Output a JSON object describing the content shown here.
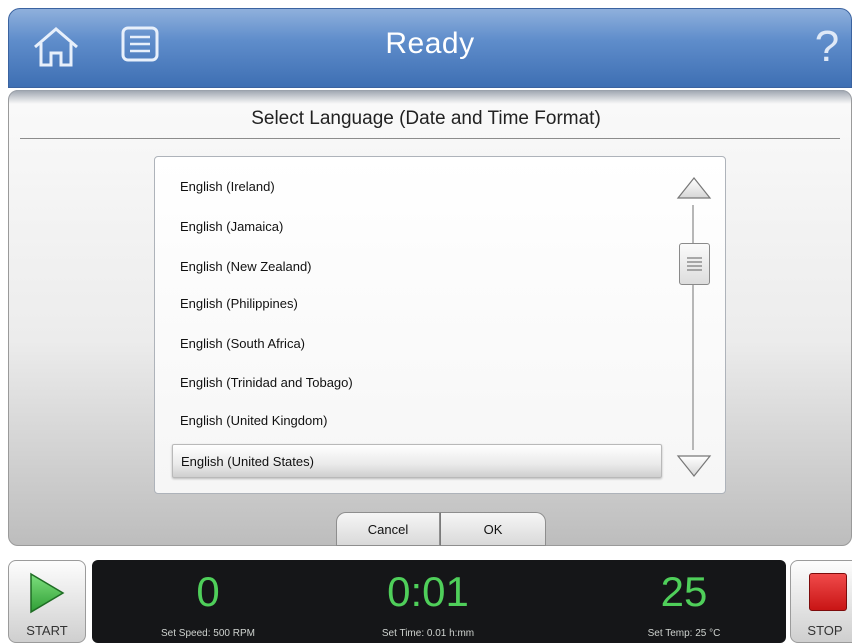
{
  "header": {
    "title": "Ready",
    "help_glyph": "?"
  },
  "dialog": {
    "title": "Select Language (Date and Time Format)",
    "items": [
      {
        "label": "English (Ireland)",
        "selected": false
      },
      {
        "label": "English (Jamaica)",
        "selected": false
      },
      {
        "label": "English (New Zealand)",
        "selected": false
      },
      {
        "label": "English (Philippines)",
        "selected": false
      },
      {
        "label": "English (South Africa)",
        "selected": false
      },
      {
        "label": "English (Trinidad and Tobago)",
        "selected": false
      },
      {
        "label": "English (United Kingdom)",
        "selected": false
      },
      {
        "label": "English (United States)",
        "selected": true
      }
    ],
    "cancel_label": "Cancel",
    "ok_label": "OK"
  },
  "controls": {
    "start_label": "START",
    "stop_label": "STOP"
  },
  "status": {
    "speed_value": "0",
    "speed_label": "Set Speed: 500 RPM",
    "time_value": "0:01",
    "time_label": "Set Time: 0.01 h:mm",
    "temp_value": "25",
    "temp_label": "Set Temp: 25 °C"
  },
  "colors": {
    "header_blue": "#4a78bd",
    "readout_green": "#4fcf5a",
    "stop_red": "#d82020"
  },
  "icons": {
    "home": "home-icon",
    "menu": "list-menu-icon",
    "help": "help-icon",
    "start": "play-icon",
    "stop": "stop-icon"
  }
}
